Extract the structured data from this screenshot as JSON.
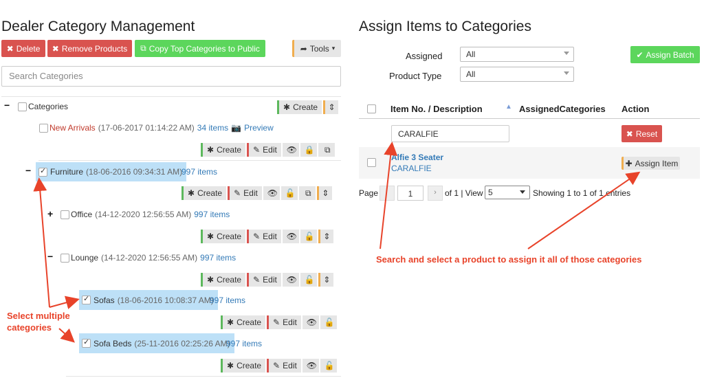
{
  "left": {
    "title": "Dealer Category Management",
    "buttons": {
      "delete": "Delete",
      "remove_products": "Remove Products",
      "copy_top": "Copy Top Categories to Public",
      "tools": "Tools"
    },
    "search_placeholder": "Search Categories",
    "root": {
      "sign": "−",
      "label": "Categories",
      "create": "Create"
    },
    "nodes": [
      {
        "name": "New Arrivals",
        "date": "(17-06-2017 01:14:22 AM)",
        "count": "34 items",
        "preview": "Preview"
      },
      {
        "sign": "−",
        "name": "Furniture",
        "date": "(18-06-2016 09:34:31 AM)",
        "count": "997 items"
      },
      {
        "sign": "+",
        "name": "Office",
        "date": "(14-12-2020 12:56:55 AM)",
        "count": "997 items"
      },
      {
        "sign": "−",
        "name": "Lounge",
        "date": "(14-12-2020 12:56:55 AM)",
        "count": "997 items"
      },
      {
        "name": "Sofas",
        "date": "(18-06-2016 10:08:37 AM)",
        "count": "997 items"
      },
      {
        "name": "Sofa Beds",
        "date": "(25-11-2016 02:25:26 AM)",
        "count": "997 items"
      }
    ],
    "actions": {
      "create": "Create",
      "edit": "Edit"
    }
  },
  "right": {
    "title": "Assign Items to Categories",
    "assigned_label": "Assigned",
    "assigned_value": "All",
    "product_type_label": "Product Type",
    "product_type_value": "All",
    "assign_batch": "Assign Batch",
    "table": {
      "headers": {
        "item": "Item No. / Description",
        "assigned": "AssignedCategories",
        "action": "Action"
      },
      "filter_value": "CARALFIE",
      "reset": "Reset",
      "rows": [
        {
          "name": "Alfie 3 Seater",
          "code": "CARALFIE",
          "action": "Assign Item"
        }
      ]
    },
    "pager": {
      "page_label": "Page",
      "page_value": "1",
      "of_text": "of 1 | View",
      "view_value": "5",
      "showing": "Showing 1 to 1 of 1 entries"
    }
  },
  "annotations": {
    "select_multiple": "Select multiple",
    "categories": "categories",
    "search_select": "Search and select a product to assign it all of those categories"
  },
  "colors": {
    "annotation": "#e8432a",
    "danger": "#d9534f",
    "success": "#5cd65c",
    "link": "#337ab7",
    "selected": "#bde0f7"
  }
}
